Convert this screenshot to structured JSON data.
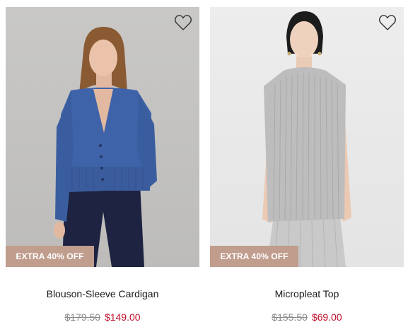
{
  "products": [
    {
      "name": "Blouson-Sleeve Cardigan",
      "badge": "EXTRA 40% OFF",
      "original_price": "$179.50",
      "sale_price": "$149.00",
      "wishlist_icon": "heart-outline-icon",
      "image_description": "model-in-blue-cardigan"
    },
    {
      "name": "Micropleat Top",
      "badge": "EXTRA 40% OFF",
      "original_price": "$155.50",
      "sale_price": "$69.00",
      "wishlist_icon": "heart-outline-icon",
      "image_description": "model-in-grey-pleated-top"
    }
  ],
  "colors": {
    "badge_bg": "#c09d8d",
    "sale_price": "#c0102b",
    "original_price": "#8a8a8a"
  }
}
